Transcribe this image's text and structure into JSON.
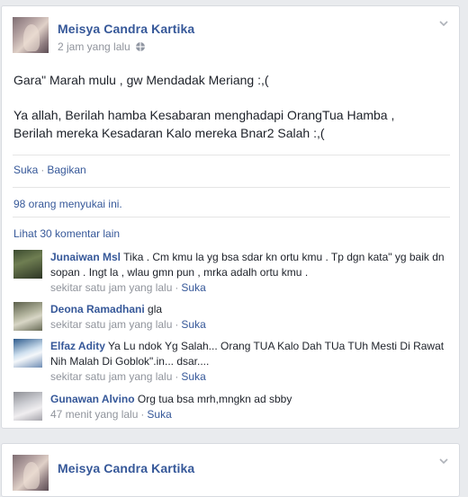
{
  "post": {
    "author": "Meisya Candra Kartika",
    "timestamp": "2 jam yang lalu",
    "paragraph1": "Gara\" Marah mulu , gw Mendadak Meriang :,(",
    "paragraph2": "Ya allah, Berilah hamba Kesabaran menghadapi OrangTua Hamba ,\nBerilah mereka Kesadaran Kalo mereka Bnar2 Salah :,(",
    "actions": {
      "like": "Suka",
      "share": "Bagikan"
    },
    "likes_text": "98 orang menyukai ini.",
    "view_more_comments": "Lihat 30 komentar lain"
  },
  "comments": [
    {
      "name": "Junaiwan Msl",
      "text": "Tika . Cm kmu la yg bsa sdar kn ortu kmu . Tp dgn kata\" yg baik dn sopan . Ingt la , wlau gmn pun , mrka adalh ortu kmu .",
      "time": "sekitar satu jam yang lalu",
      "like": "Suka"
    },
    {
      "name": "Deona Ramadhani",
      "text": "gla",
      "time": "sekitar satu jam yang lalu",
      "like": "Suka"
    },
    {
      "name": "Elfaz Adity",
      "text": "Ya Lu ndok Yg Salah... Orang TUA Kalo Dah TUa TUh Mesti Di Rawat Nih Malah Di Goblok\".in... dsar....",
      "time": "sekitar satu jam yang lalu",
      "like": "Suka"
    },
    {
      "name": "Gunawan Alvino",
      "text": "Org tua bsa mrh,mngkn ad sbby",
      "time": "47 menit yang lalu",
      "like": "Suka"
    }
  ],
  "next_post": {
    "author": "Meisya Candra Kartika"
  },
  "colors": {
    "link": "#365899",
    "meta": "#90949c",
    "background": "#e9ebee"
  },
  "icons": {
    "privacy": "globe-icon",
    "menu": "chevron-down-icon"
  }
}
